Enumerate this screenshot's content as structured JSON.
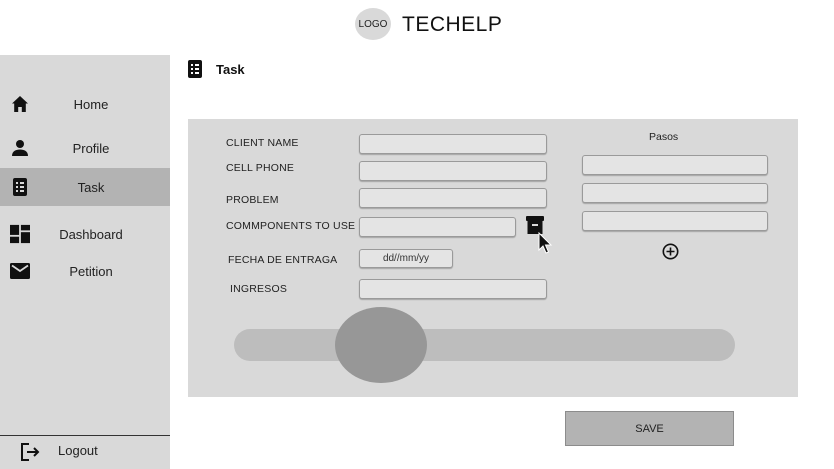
{
  "header": {
    "logo_text": "LOGO",
    "brand": "TECHELP"
  },
  "sidebar": {
    "items": [
      {
        "label": "Home",
        "icon": "home-icon"
      },
      {
        "label": "Profile",
        "icon": "person-icon"
      },
      {
        "label": "Task",
        "icon": "task-icon",
        "active": true
      },
      {
        "label": "Dashboard",
        "icon": "dashboard-icon"
      },
      {
        "label": "Petition",
        "icon": "mail-icon"
      }
    ],
    "logout_label": "Logout"
  },
  "page": {
    "title": "Task"
  },
  "form": {
    "client_name_label": "CLIENT NAME",
    "client_name_value": "",
    "cell_phone_label": "CELL PHONE",
    "cell_phone_value": "",
    "problem_label": "PROBLEM",
    "problem_value": "",
    "components_label": "COMMPONENTS TO USE",
    "components_value": "",
    "delivery_date_label": "FECHA DE ENTRAGA",
    "delivery_date_placeholder": "dd//mm/yy",
    "income_label": "INGRESOS",
    "income_value": ""
  },
  "steps": {
    "title": "Pasos",
    "values": [
      "",
      "",
      ""
    ]
  },
  "slider": {
    "position_fraction": 0.29
  },
  "actions": {
    "save_label": "SAVE"
  },
  "colors": {
    "sidebar_bg": "#d9d9d9",
    "sidebar_active": "#b3b3b3",
    "panel_bg": "#d9d9d9",
    "slider_thumb": "#979797"
  }
}
